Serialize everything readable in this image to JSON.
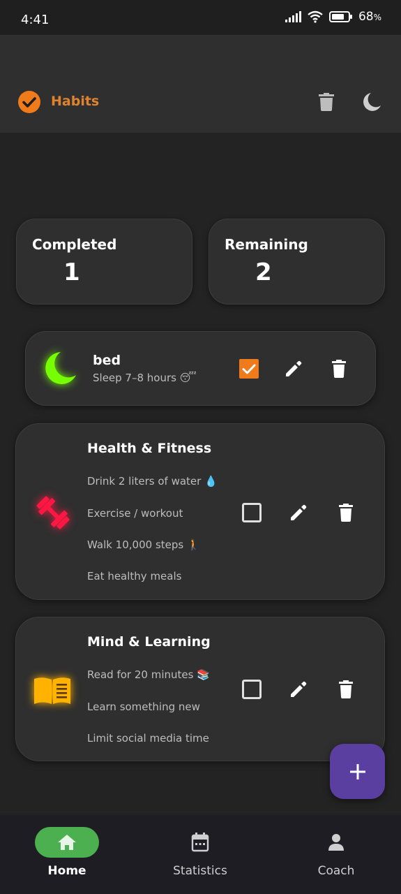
{
  "status_bar": {
    "time": "4:41",
    "battery": "68",
    "battery_unit": "%"
  },
  "app_bar": {
    "title": "Habits",
    "icons": [
      "check-circle-icon",
      "trash-icon",
      "moon-icon"
    ]
  },
  "stats": {
    "completed": {
      "label": "Completed",
      "value": "1"
    },
    "remaining": {
      "label": "Remaining",
      "value": "2"
    }
  },
  "habits": [
    {
      "title": "bed",
      "items": [
        "Sleep 7–8 hours 😴"
      ],
      "checked": true,
      "icon": "moon-icon"
    },
    {
      "title": "Health & Fitness",
      "items": [
        "Drink 2 liters of water 💧",
        "Exercise / workout",
        "Walk 10,000 steps 🚶",
        "Eat healthy meals"
      ],
      "checked": false,
      "icon": "dumbbell-icon"
    },
    {
      "title": "Mind & Learning",
      "items": [
        "Read for 20 minutes 📚",
        "Learn something new",
        "Limit social media time"
      ],
      "checked": false,
      "icon": "book-icon"
    }
  ],
  "fab": {
    "icon": "plus-icon"
  },
  "bottom_nav": [
    {
      "label": "Home",
      "icon": "home-icon",
      "active": true
    },
    {
      "label": "Statistics",
      "icon": "calendar-icon",
      "active": false
    },
    {
      "label": "Coach",
      "icon": "person-icon",
      "active": false
    }
  ],
  "colors": {
    "accent": "#e0832f",
    "checkbox": "#f07b1a",
    "fab": "#5b3fa0",
    "nav_active": "#4caf50",
    "moon": "#76ff03",
    "dumbbell": "#ff1744",
    "book": "#ffb300"
  }
}
